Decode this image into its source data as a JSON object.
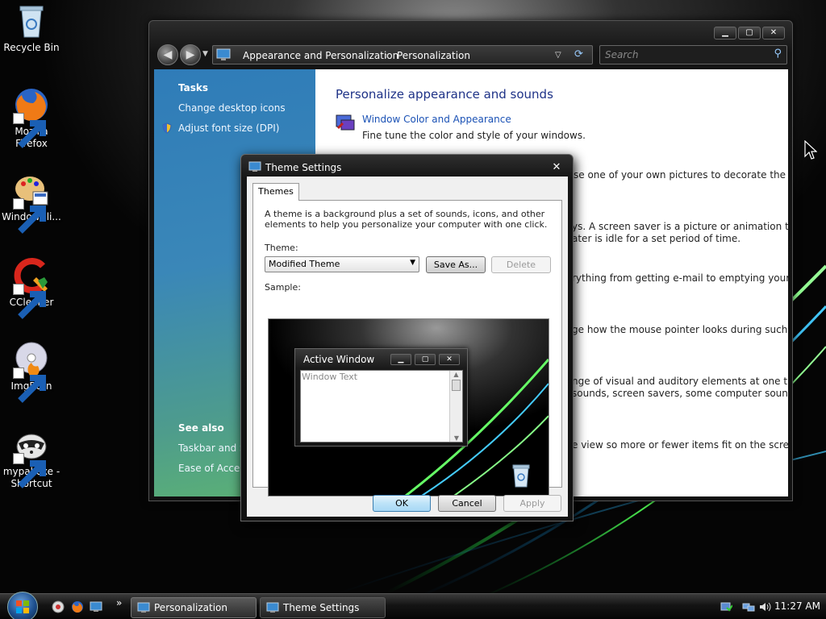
{
  "desktop": {
    "icons": [
      {
        "label_line1": "Recycle Bin",
        "label_line2": ""
      },
      {
        "label_line1": "Mozilla",
        "label_line2": "Firefox"
      },
      {
        "label_line1": "WindowBli...",
        "label_line2": ""
      },
      {
        "label_line1": "CCleaner",
        "label_line2": ""
      },
      {
        "label_line1": "ImgBurn",
        "label_line2": ""
      },
      {
        "label_line1": "mypal.exe -",
        "label_line2": "Shortcut"
      }
    ]
  },
  "explorer": {
    "breadcrumb": [
      "Appearance and Personalization",
      "Personalization"
    ],
    "search_placeholder": "Search",
    "sidebar": {
      "tasks_heading": "Tasks",
      "tasks": [
        "Change desktop icons",
        "Adjust font size (DPI)"
      ],
      "see_also_heading": "See also",
      "see_also": [
        "Taskbar and St",
        "Ease of Access"
      ]
    },
    "content": {
      "title": "Personalize appearance and sounds",
      "first_item_link": "Window Color and Appearance",
      "first_item_desc": "Fine tune the color and style of your windows.",
      "partial_lines": [
        "se one of your own pictures to decorate the",
        "ys. A screen saver is a picture or animation that",
        "ater is idle for a set period of time.",
        "rything from getting e-mail to emptying your",
        "ge how the mouse pointer looks during such",
        "nge of visual and auditory elements at one time",
        "sounds, screen savers, some computer sounds,",
        "e view so more or fewer items fit on the screen."
      ]
    }
  },
  "dialog": {
    "title": "Theme Settings",
    "tab_label": "Themes",
    "description_line1": "A theme is a background plus a set of sounds, icons, and other",
    "description_line2": "elements to help you personalize your computer with one click.",
    "theme_label": "Theme:",
    "theme_selected": "Modified Theme",
    "save_as_label": "Save As...",
    "delete_label": "Delete",
    "sample_label": "Sample:",
    "preview": {
      "window_title": "Active Window",
      "window_text": "Window Text"
    },
    "ok_label": "OK",
    "cancel_label": "Cancel",
    "apply_label": "Apply"
  },
  "taskbar": {
    "buttons": [
      {
        "label": "Personalization"
      },
      {
        "label": "Theme Settings"
      }
    ],
    "overflow_chevron": "»",
    "clock": "11:27 AM"
  }
}
